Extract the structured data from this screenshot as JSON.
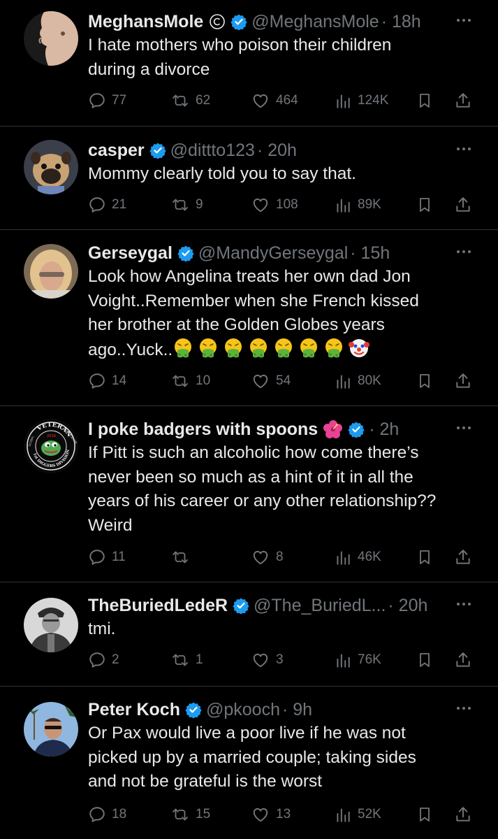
{
  "colors": {
    "background": "#000000",
    "text": "#e7e9ea",
    "muted": "#71767b",
    "verified": "#1d9bf0",
    "divider": "#2f3336"
  },
  "tweets": [
    {
      "name": "MeghansMole",
      "badge": "copyright-icon",
      "handle": "@MeghansMole",
      "time": "· 18h",
      "text_lines": [
        "I hate mothers who poison their children",
        "during a divorce"
      ],
      "replies": "77",
      "reposts": "62",
      "likes": "464",
      "views": "124K"
    },
    {
      "name": "casper",
      "handle": "@dittto123",
      "time": "· 20h",
      "text_lines": [
        "Mommy clearly told you to say that."
      ],
      "replies": "21",
      "reposts": "9",
      "likes": "108",
      "views": "89K"
    },
    {
      "name": "Gerseygal",
      "handle": "@MandyGerseygal",
      "time": "· 15h",
      "text_lines": [
        "Look how Angelina treats her own dad Jon",
        "Voight..Remember when she French kissed",
        "her brother at the Golden Globes years",
        "ago..Yuck.."
      ],
      "emojis": [
        "vomiting-face",
        "vomiting-face",
        "vomiting-face",
        "vomiting-face",
        "vomiting-face",
        "vomiting-face",
        "vomiting-face",
        "clown-face"
      ],
      "replies": "14",
      "reposts": "10",
      "likes": "54",
      "views": "80K"
    },
    {
      "name": "I poke badgers with spoons",
      "badge": "hibiscus-icon",
      "time": "· 2h",
      "text_lines": [
        "If Pitt is such an alcoholic how come there’s",
        "never been so much as a hint of it in all the",
        "years of his career or any other relationship??",
        "Weird"
      ],
      "avatar_text": {
        "top": "VETERAN",
        "left": "GLOBAL",
        "right": "APPLICATION",
        "year": "2019",
        "bottom": "1st DIGGERS DIVISION"
      },
      "replies": "11",
      "reposts": "",
      "likes": "8",
      "views": "46K"
    },
    {
      "name": "TheBuriedLedeR",
      "handle": "@The_BuriedL...",
      "time": "· 20h",
      "text_lines": [
        "tmi."
      ],
      "replies": "2",
      "reposts": "1",
      "likes": "3",
      "views": "76K"
    },
    {
      "name": "Peter Koch",
      "handle": "@pkooch",
      "time": "· 9h",
      "text_lines": [
        "Or Pax would live a poor live if he was not",
        "picked up by a married couple; taking sides",
        "and not be grateful is the worst"
      ],
      "replies": "18",
      "reposts": "15",
      "likes": "13",
      "views": "52K"
    }
  ]
}
